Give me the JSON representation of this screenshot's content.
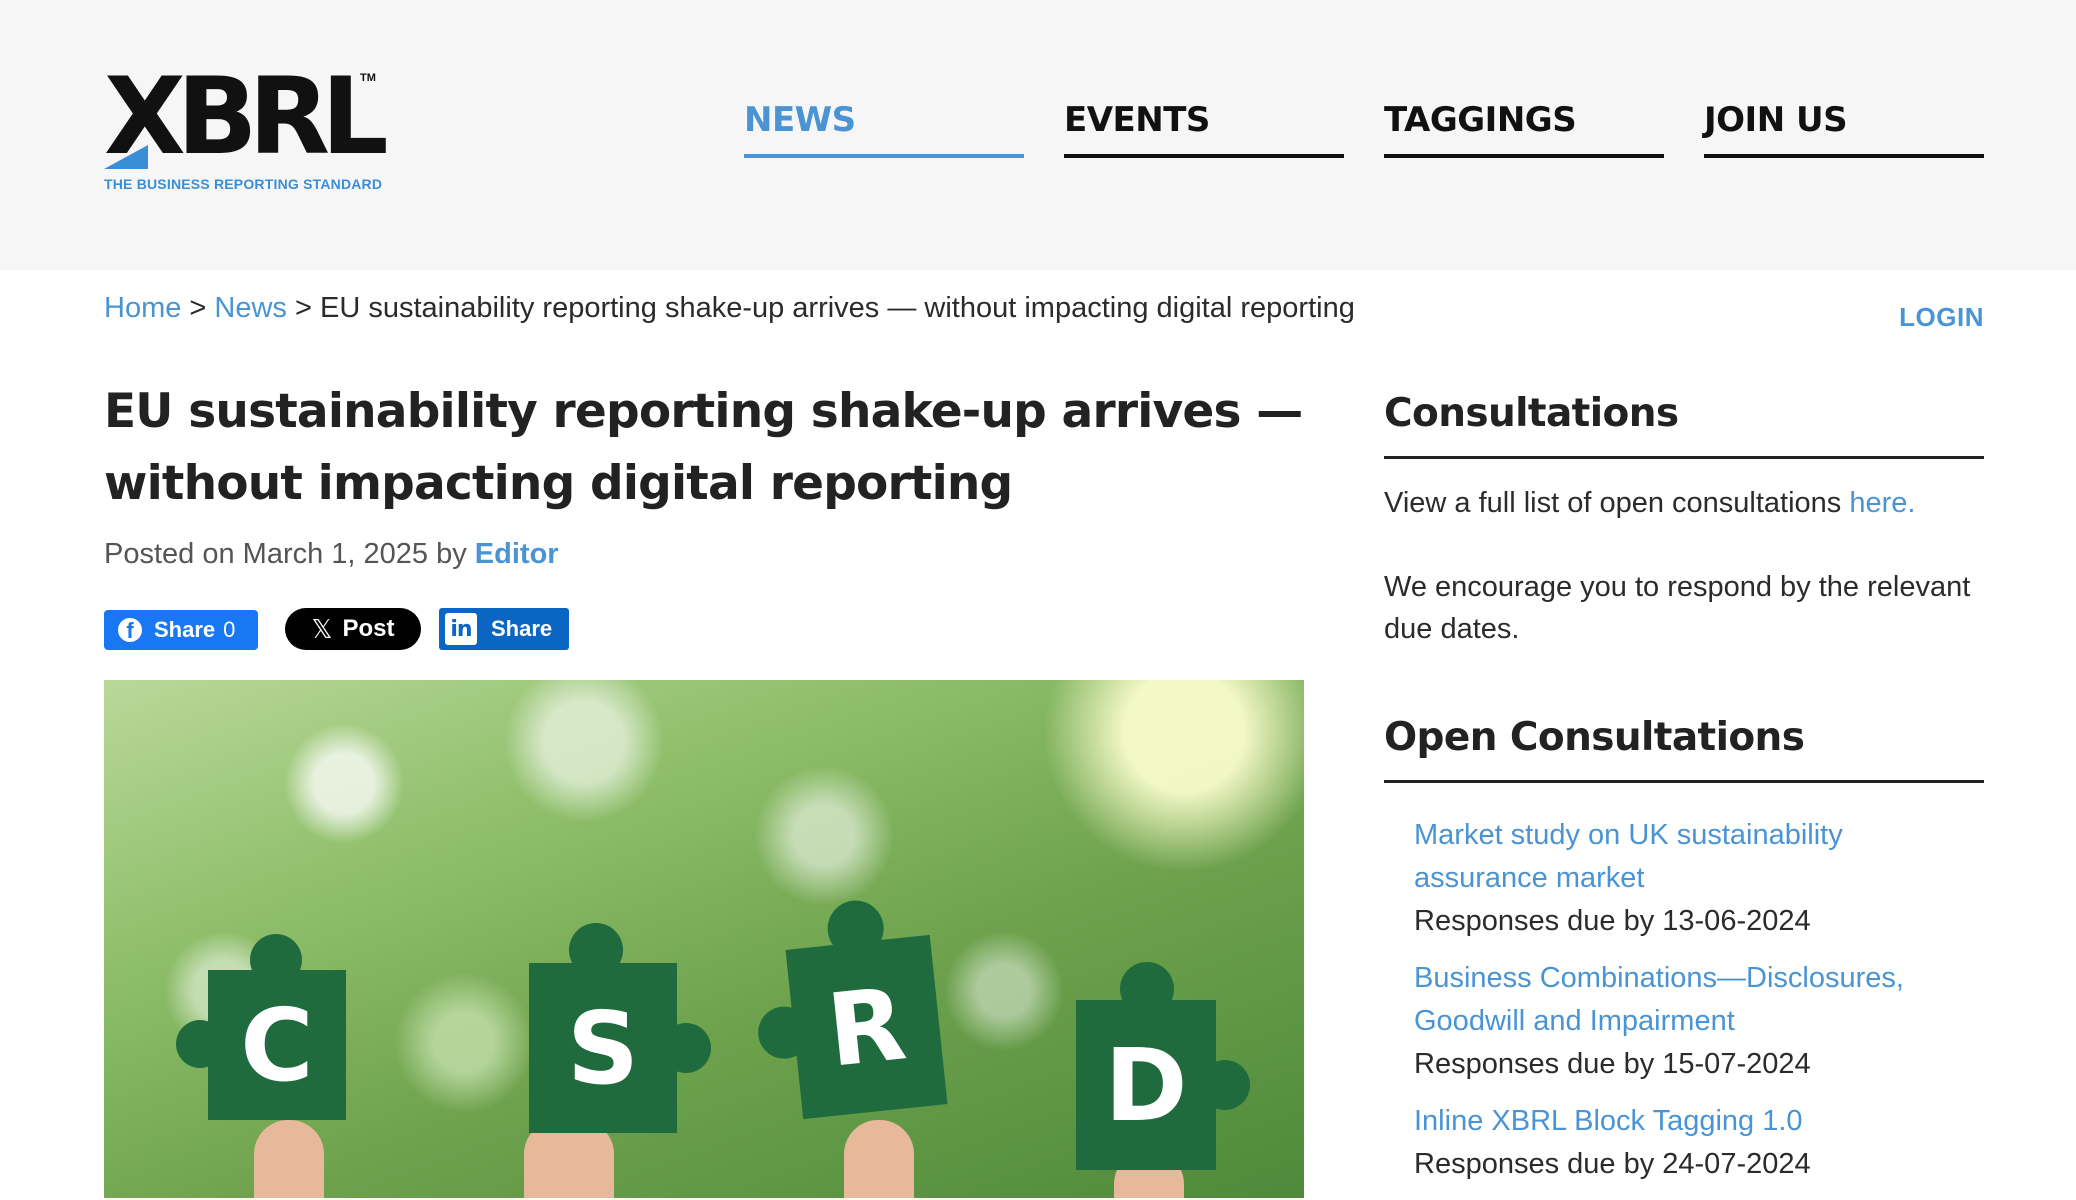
{
  "brand": {
    "logo_text": "XBRL",
    "tagline": "THE BUSINESS REPORTING STANDARD",
    "trademark": "TM",
    "accent": "#4a94d4"
  },
  "nav": {
    "items": [
      {
        "label": "NEWS",
        "active": true
      },
      {
        "label": "EVENTS",
        "active": false
      },
      {
        "label": "TAGGINGS",
        "active": false
      },
      {
        "label": "JOIN US",
        "active": false
      }
    ]
  },
  "breadcrumb": {
    "home": "Home",
    "sep": ">",
    "news": "News",
    "current": "EU sustainability reporting shake-up arrives — without impacting digital reporting"
  },
  "login_label": "LOGIN",
  "article": {
    "title": "EU sustainability reporting shake-up arrives — without impacting digital reporting",
    "posted_prefix": "Posted on March 1, 2025 by",
    "author": "Editor",
    "image_letters": [
      "C",
      "S",
      "R",
      "D"
    ]
  },
  "share": {
    "facebook_label": "Share",
    "facebook_count": "0",
    "x_label": "Post",
    "linkedin_label": "Share"
  },
  "sidebar": {
    "consultations_heading": "Consultations",
    "consultations_text": "View a full list of open consultations",
    "consultations_link": "here.",
    "encourage_text": "We encourage you to respond by the relevant due dates.",
    "open_heading": "Open Consultations",
    "open_items": [
      {
        "title": "Market study on UK sustainability assurance market",
        "due": "Responses due by 13-06-2024"
      },
      {
        "title": "Business Combinations—Disclosures, Goodwill and Impairment",
        "due": "Responses due by 15-07-2024"
      },
      {
        "title": "Inline XBRL Block Tagging 1.0",
        "due": "Responses due by 24-07-2024"
      }
    ]
  }
}
